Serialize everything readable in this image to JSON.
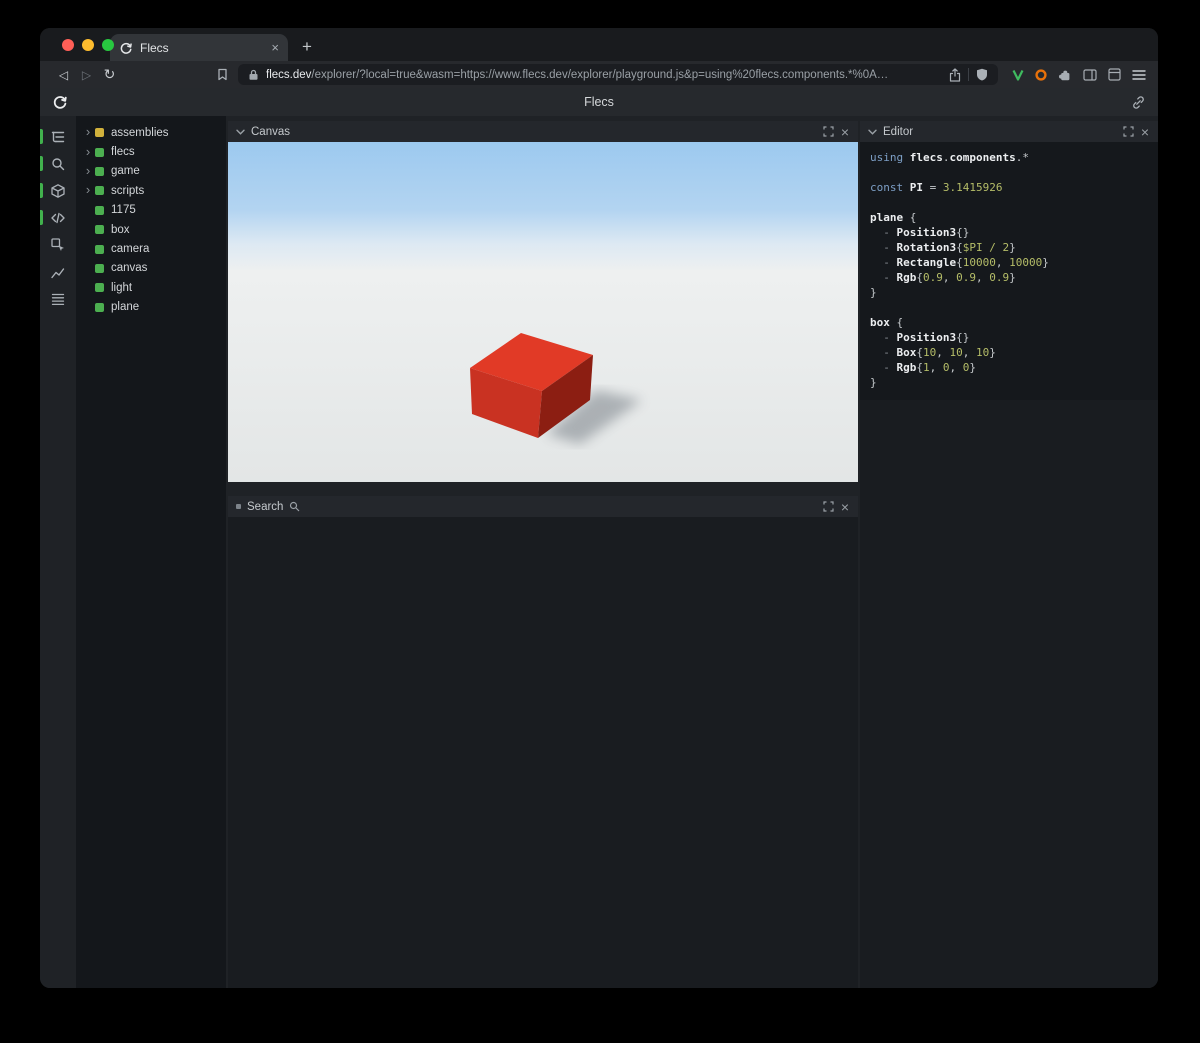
{
  "browser": {
    "tab": {
      "title": "Flecs",
      "close": "×"
    },
    "new_tab": "+",
    "back": "◁",
    "forward": "▷",
    "reload": "↻",
    "url_domain": "flecs.dev",
    "url_rest": "/explorer/?local=true&wasm=https://www.flecs.dev/explorer/playground.js&p=using%20flecs.components.*%0A…"
  },
  "header": {
    "title": "Flecs"
  },
  "rail": {
    "items": [
      {
        "name": "entity-tree",
        "active": true
      },
      {
        "name": "search",
        "active": true
      },
      {
        "name": "canvas",
        "active": true
      },
      {
        "name": "editor",
        "active": true
      },
      {
        "name": "inspector",
        "active": false
      },
      {
        "name": "stats",
        "active": false
      },
      {
        "name": "tables",
        "active": false
      }
    ]
  },
  "tree": {
    "items": [
      {
        "label": "assemblies",
        "color": "#d1b13c",
        "expandable": true
      },
      {
        "label": "flecs",
        "color": "#4caf50",
        "expandable": true
      },
      {
        "label": "game",
        "color": "#4caf50",
        "expandable": true
      },
      {
        "label": "scripts",
        "color": "#4caf50",
        "expandable": true
      },
      {
        "label": "1175",
        "color": "#4caf50",
        "expandable": false
      },
      {
        "label": "box",
        "color": "#4caf50",
        "expandable": false
      },
      {
        "label": "camera",
        "color": "#4caf50",
        "expandable": false
      },
      {
        "label": "canvas",
        "color": "#4caf50",
        "expandable": false
      },
      {
        "label": "light",
        "color": "#4caf50",
        "expandable": false
      },
      {
        "label": "plane",
        "color": "#4caf50",
        "expandable": false
      }
    ]
  },
  "panels": {
    "canvas": {
      "title": "Canvas",
      "close": "×"
    },
    "search": {
      "title": "Search",
      "close": "×"
    },
    "editor": {
      "title": "Editor",
      "close": "×"
    }
  },
  "scene": {
    "sky_top": "#9cc9ef",
    "sky_mid": "#b3d4f1",
    "horizon": "#dde9f3",
    "ground_near": "#eef0f0",
    "ground_far": "#e3e6e6",
    "box_top": "#e13a26",
    "box_front": "#c93222",
    "box_right": "#8c1e12",
    "shadow": "#646c74",
    "accent_green": "#41b14d"
  },
  "editor": {
    "lines": [
      [
        {
          "t": "using",
          "c": "kw"
        },
        {
          "t": " ",
          "c": "pl"
        },
        {
          "t": "flecs",
          "c": "id"
        },
        {
          "t": ".",
          "c": "pl"
        },
        {
          "t": "components",
          "c": "id"
        },
        {
          "t": ".*",
          "c": "pl"
        }
      ],
      [],
      [
        {
          "t": "const",
          "c": "kw"
        },
        {
          "t": " ",
          "c": "pl"
        },
        {
          "t": "PI",
          "c": "id"
        },
        {
          "t": " = ",
          "c": "pl"
        },
        {
          "t": "3.1415926",
          "c": "num"
        }
      ],
      [],
      [
        {
          "t": "plane",
          "c": "id"
        },
        {
          "t": " {",
          "c": "pl"
        }
      ],
      [
        {
          "t": "  - ",
          "c": "dash"
        },
        {
          "t": "Position3",
          "c": "id"
        },
        {
          "t": "{}",
          "c": "pl"
        }
      ],
      [
        {
          "t": "  - ",
          "c": "dash"
        },
        {
          "t": "Rotation3",
          "c": "id"
        },
        {
          "t": "{",
          "c": "pl"
        },
        {
          "t": "$PI / 2",
          "c": "num"
        },
        {
          "t": "}",
          "c": "pl"
        }
      ],
      [
        {
          "t": "  - ",
          "c": "dash"
        },
        {
          "t": "Rectangle",
          "c": "id"
        },
        {
          "t": "{",
          "c": "pl"
        },
        {
          "t": "10000",
          "c": "num"
        },
        {
          "t": ", ",
          "c": "pl"
        },
        {
          "t": "10000",
          "c": "num"
        },
        {
          "t": "}",
          "c": "pl"
        }
      ],
      [
        {
          "t": "  - ",
          "c": "dash"
        },
        {
          "t": "Rgb",
          "c": "id"
        },
        {
          "t": "{",
          "c": "pl"
        },
        {
          "t": "0.9",
          "c": "num"
        },
        {
          "t": ", ",
          "c": "pl"
        },
        {
          "t": "0.9",
          "c": "num"
        },
        {
          "t": ", ",
          "c": "pl"
        },
        {
          "t": "0.9",
          "c": "num"
        },
        {
          "t": "}",
          "c": "pl"
        }
      ],
      [
        {
          "t": "}",
          "c": "pl"
        }
      ],
      [],
      [
        {
          "t": "box",
          "c": "id"
        },
        {
          "t": " {",
          "c": "pl"
        }
      ],
      [
        {
          "t": "  - ",
          "c": "dash"
        },
        {
          "t": "Position3",
          "c": "id"
        },
        {
          "t": "{}",
          "c": "pl"
        }
      ],
      [
        {
          "t": "  - ",
          "c": "dash"
        },
        {
          "t": "Box",
          "c": "id"
        },
        {
          "t": "{",
          "c": "pl"
        },
        {
          "t": "10",
          "c": "num"
        },
        {
          "t": ", ",
          "c": "pl"
        },
        {
          "t": "10",
          "c": "num"
        },
        {
          "t": ", ",
          "c": "pl"
        },
        {
          "t": "10",
          "c": "num"
        },
        {
          "t": "}",
          "c": "pl"
        }
      ],
      [
        {
          "t": "  - ",
          "c": "dash"
        },
        {
          "t": "Rgb",
          "c": "id"
        },
        {
          "t": "{",
          "c": "pl"
        },
        {
          "t": "1",
          "c": "num"
        },
        {
          "t": ", ",
          "c": "pl"
        },
        {
          "t": "0",
          "c": "num"
        },
        {
          "t": ", ",
          "c": "pl"
        },
        {
          "t": "0",
          "c": "num"
        },
        {
          "t": "}",
          "c": "pl"
        }
      ],
      [
        {
          "t": "}",
          "c": "pl"
        }
      ]
    ]
  }
}
